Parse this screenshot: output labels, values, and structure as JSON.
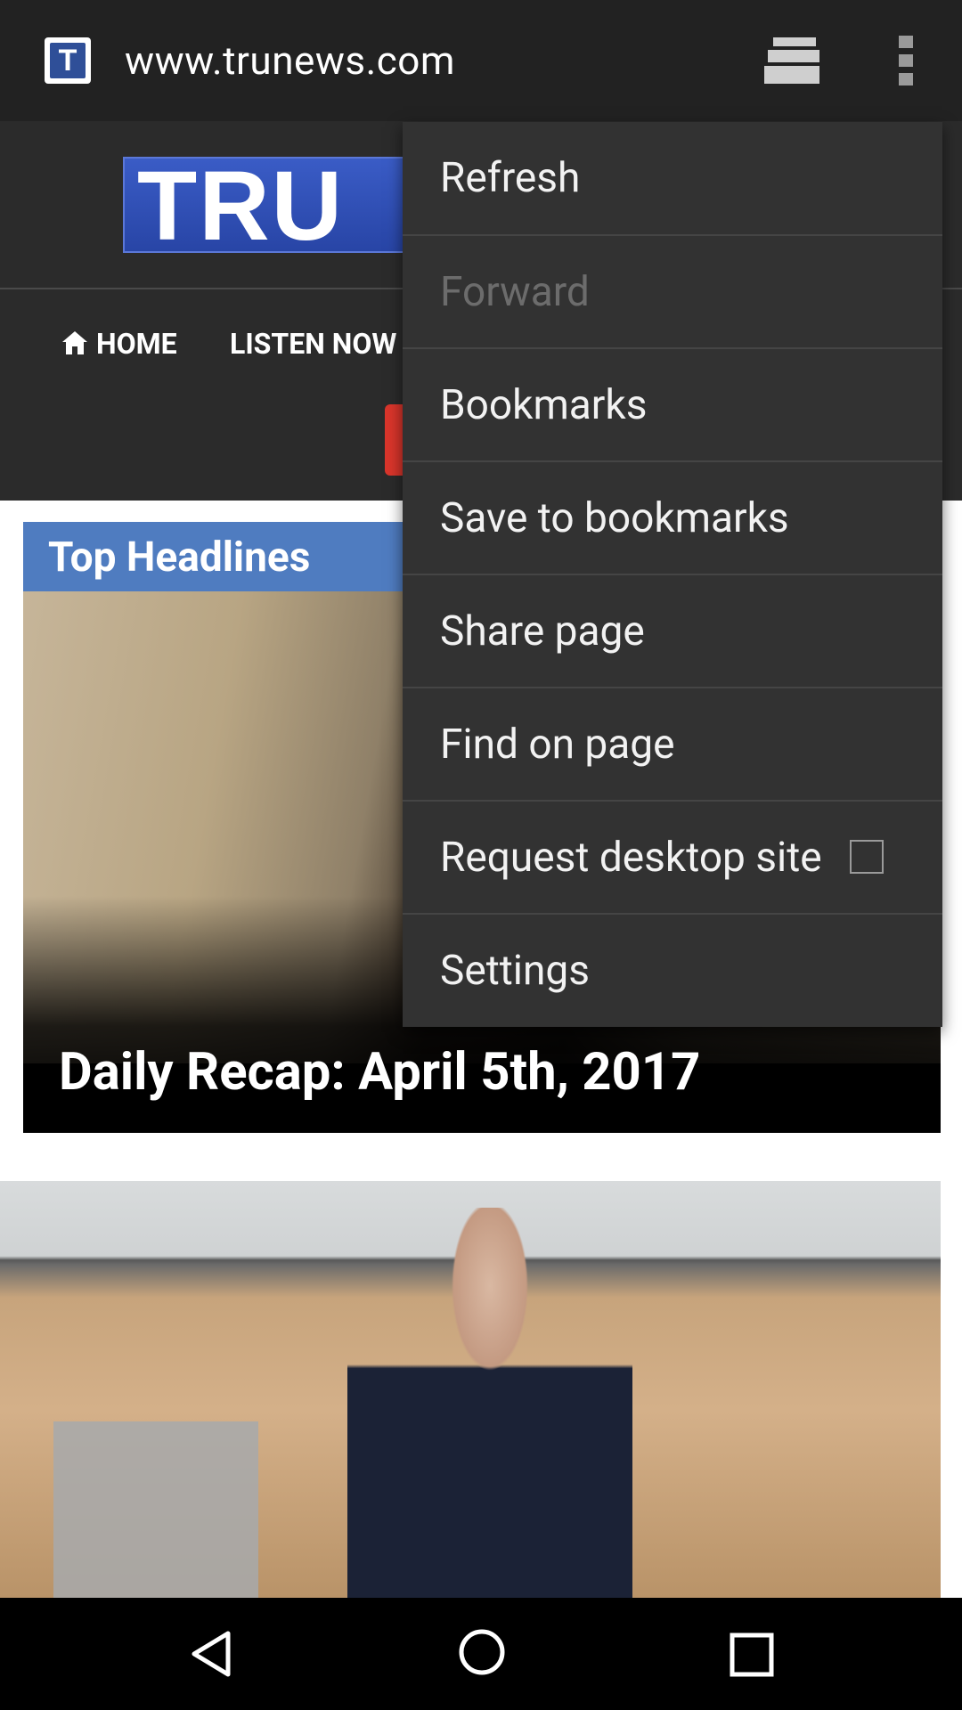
{
  "browser": {
    "url": "www.trunews.com",
    "favicon_letter": "T"
  },
  "site": {
    "logo_text": "TRU",
    "nav": {
      "home_label": "HOME",
      "listen_label": "LISTEN NOW"
    }
  },
  "content": {
    "section_label": "Top Headlines",
    "headline": "Daily Recap: April 5th, 2017"
  },
  "menu": {
    "items": [
      {
        "label": "Refresh",
        "enabled": true
      },
      {
        "label": "Forward",
        "enabled": false
      },
      {
        "label": "Bookmarks",
        "enabled": true
      },
      {
        "label": "Save to bookmarks",
        "enabled": true
      },
      {
        "label": "Share page",
        "enabled": true
      },
      {
        "label": "Find on page",
        "enabled": true
      },
      {
        "label": "Request desktop site",
        "enabled": true,
        "checked": false
      },
      {
        "label": "Settings",
        "enabled": true
      }
    ]
  },
  "icons": {
    "toolbar": [
      "tab-switcher-icon",
      "more-vert-icon"
    ],
    "navbar": [
      "back-icon",
      "home-icon",
      "recents-icon"
    ],
    "site": [
      "house-icon"
    ]
  },
  "colors": {
    "toolbar": "#222222",
    "menu_bg": "#323232",
    "logo_blue": "#2845a6",
    "accent_red": "#d9352b",
    "headline_band": "#4f7cc0"
  }
}
